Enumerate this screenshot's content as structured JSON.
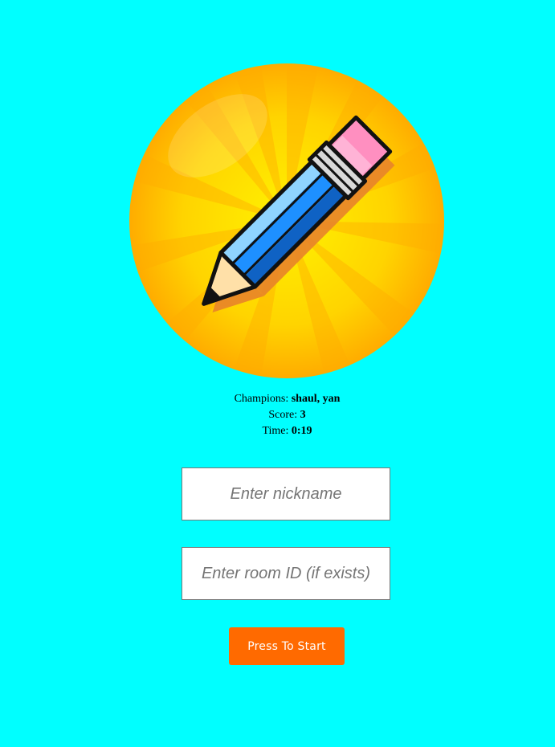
{
  "logo": {
    "icon": "pencil-icon"
  },
  "stats": {
    "champions_label": "Champions:",
    "champions_value": "shaul, yan",
    "score_label": "Score:",
    "score_value": "3",
    "time_label": "Time:",
    "time_value": "0:19"
  },
  "form": {
    "nickname_placeholder": "Enter nickname",
    "room_placeholder": "Enter room ID (if exists)",
    "start_label": "Press To Start"
  },
  "colors": {
    "background": "#00ffff",
    "button": "#ff6a00",
    "logo_circle": "#ffcc00",
    "pencil_body": "#1e90ff",
    "eraser": "#ff8fc0"
  }
}
